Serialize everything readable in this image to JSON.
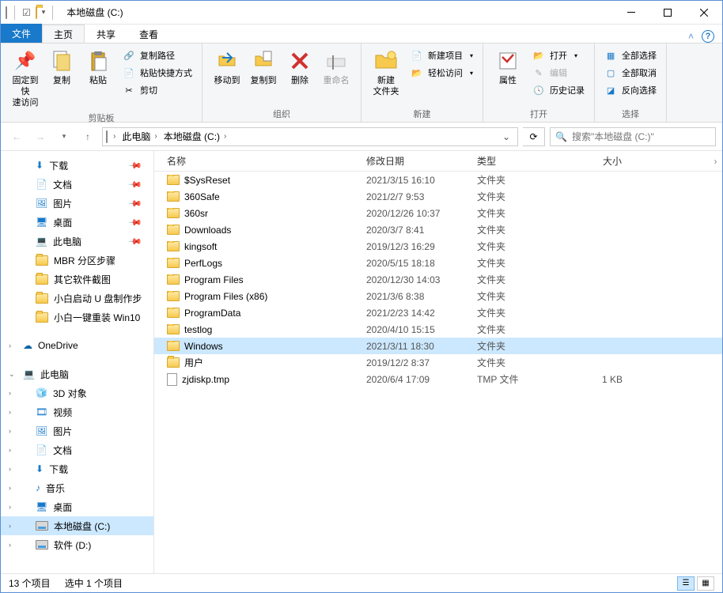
{
  "title": "本地磁盘 (C:)",
  "tabs": {
    "file": "文件",
    "home": "主页",
    "share": "共享",
    "view": "查看"
  },
  "ribbon": {
    "pin": "固定到快\n速访问",
    "copy": "复制",
    "paste": "粘贴",
    "copypath": "复制路径",
    "pasteshortcut": "粘贴快捷方式",
    "cut": "剪切",
    "clipboard_grp": "剪贴板",
    "moveto": "移动到",
    "copyto": "复制到",
    "delete": "删除",
    "rename": "重命名",
    "organize_grp": "组织",
    "newfolder": "新建\n文件夹",
    "newitem": "新建项目",
    "easyaccess": "轻松访问",
    "new_grp": "新建",
    "properties": "属性",
    "open": "打开",
    "edit": "编辑",
    "history": "历史记录",
    "open_grp": "打开",
    "selectall": "全部选择",
    "selectnone": "全部取消",
    "invertsel": "反向选择",
    "select_grp": "选择"
  },
  "breadcrumb": {
    "this_pc": "此电脑",
    "drive": "本地磁盘 (C:)"
  },
  "search_placeholder": "搜索\"本地磁盘 (C:)\"",
  "nav": {
    "downloads": "下载",
    "documents": "文档",
    "pictures": "图片",
    "desktop": "桌面",
    "thispc": "此电脑",
    "mbr": "MBR 分区步骤",
    "other": "其它软件截图",
    "xiaobai1": "小白启动 U 盘制作步",
    "xiaobai2": "小白一键重装 Win10",
    "onedrive": "OneDrive",
    "thispc2": "此电脑",
    "obj3d": "3D 对象",
    "videos": "视频",
    "pictures2": "图片",
    "documents2": "文档",
    "downloads2": "下载",
    "music": "音乐",
    "desktop2": "桌面",
    "cdrive": "本地磁盘 (C:)",
    "ddrive": "软件 (D:)"
  },
  "columns": {
    "name": "名称",
    "date": "修改日期",
    "type": "类型",
    "size": "大小"
  },
  "files": [
    {
      "name": "$SysReset",
      "date": "2021/3/15 16:10",
      "type": "文件夹",
      "size": "",
      "icon": "folder"
    },
    {
      "name": "360Safe",
      "date": "2021/2/7 9:53",
      "type": "文件夹",
      "size": "",
      "icon": "folder"
    },
    {
      "name": "360sr",
      "date": "2020/12/26 10:37",
      "type": "文件夹",
      "size": "",
      "icon": "folder"
    },
    {
      "name": "Downloads",
      "date": "2020/3/7 8:41",
      "type": "文件夹",
      "size": "",
      "icon": "folder"
    },
    {
      "name": "kingsoft",
      "date": "2019/12/3 16:29",
      "type": "文件夹",
      "size": "",
      "icon": "folder"
    },
    {
      "name": "PerfLogs",
      "date": "2020/5/15 18:18",
      "type": "文件夹",
      "size": "",
      "icon": "folder"
    },
    {
      "name": "Program Files",
      "date": "2020/12/30 14:03",
      "type": "文件夹",
      "size": "",
      "icon": "folder"
    },
    {
      "name": "Program Files (x86)",
      "date": "2021/3/6 8:38",
      "type": "文件夹",
      "size": "",
      "icon": "folder"
    },
    {
      "name": "ProgramData",
      "date": "2021/2/23 14:42",
      "type": "文件夹",
      "size": "",
      "icon": "folder"
    },
    {
      "name": "testlog",
      "date": "2020/4/10 15:15",
      "type": "文件夹",
      "size": "",
      "icon": "folder"
    },
    {
      "name": "Windows",
      "date": "2021/3/11 18:30",
      "type": "文件夹",
      "size": "",
      "icon": "folder",
      "selected": true
    },
    {
      "name": "用户",
      "date": "2019/12/2 8:37",
      "type": "文件夹",
      "size": "",
      "icon": "folder"
    },
    {
      "name": "zjdiskp.tmp",
      "date": "2020/6/4 17:09",
      "type": "TMP 文件",
      "size": "1 KB",
      "icon": "file"
    }
  ],
  "status": {
    "count": "13 个项目",
    "selected": "选中 1 个项目"
  }
}
